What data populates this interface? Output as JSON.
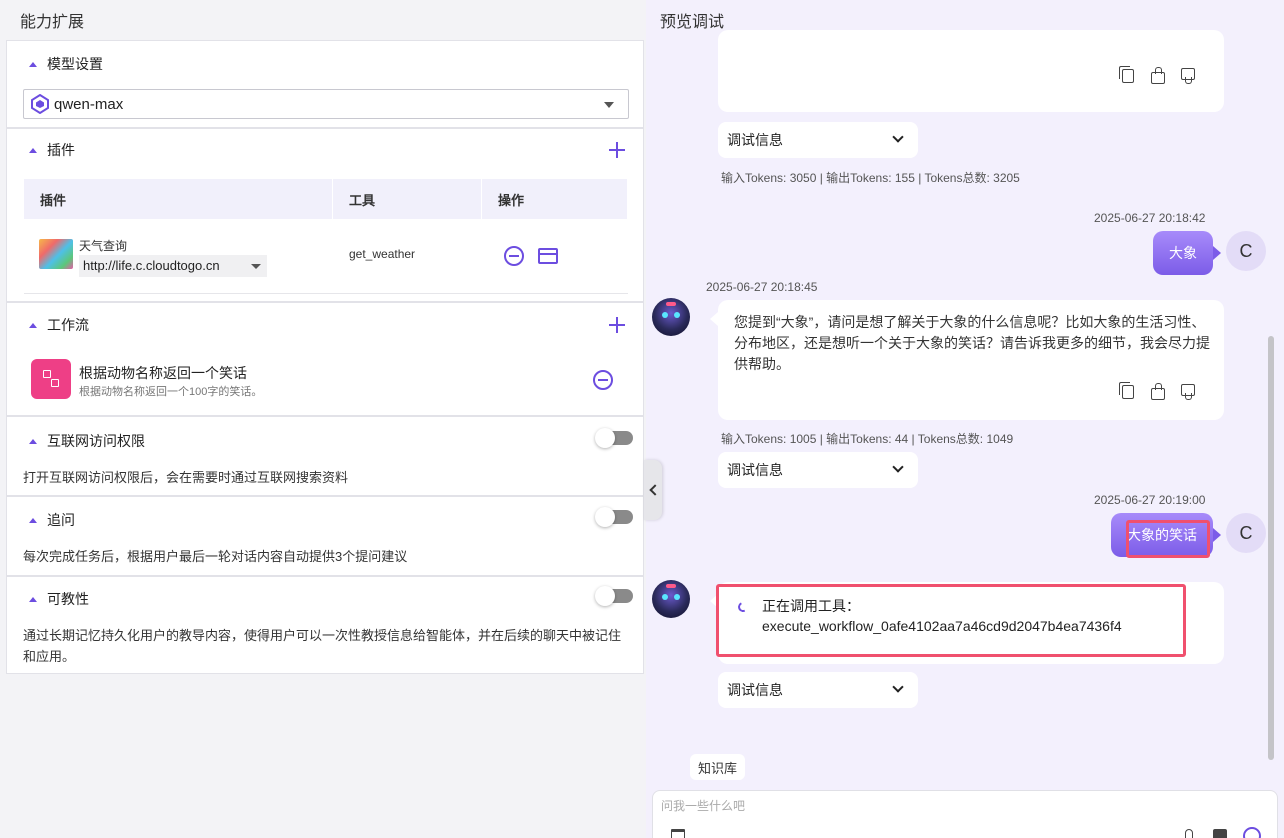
{
  "left_panel": {
    "title": "能力扩展",
    "model_section": {
      "title": "模型设置",
      "selected_model": "qwen-max"
    },
    "plugin_section": {
      "title": "插件",
      "columns": [
        "插件",
        "工具",
        "操作"
      ],
      "rows": [
        {
          "name": "天气查询",
          "url": "http://life.c.cloudtogo.cn",
          "tool": "get_weather"
        }
      ]
    },
    "workflow_section": {
      "title": "工作流",
      "items": [
        {
          "name": "根据动物名称返回一个笑话",
          "desc": "根据动物名称返回一个100字的笑话。"
        }
      ]
    },
    "internet_section": {
      "title": "互联网访问权限",
      "desc": "打开互联网访问权限后，会在需要时通过互联网搜索资料",
      "enabled": false
    },
    "followup_section": {
      "title": "追问",
      "desc": "每次完成任务后，根据用户最后一轮对话内容自动提供3个提问建议",
      "enabled": false
    },
    "teachable_section": {
      "title": "可教性",
      "desc": "通过长期记忆持久化用户的教导内容，使得用户可以一次性教授信息给智能体，并在后续的聊天中被记住和应用。",
      "enabled": false
    }
  },
  "right_panel": {
    "title": "预览调试",
    "debug_label": "调试信息",
    "messages": [
      {
        "role": "bot-tail",
        "tokens": "输入Tokens: 3050 |  输出Tokens: 155 |  Tokens总数: 3205"
      },
      {
        "role": "user",
        "time": "2025-06-27 20:18:42",
        "text": "大象",
        "avatar": "C"
      },
      {
        "role": "bot",
        "time": "2025-06-27 20:18:45",
        "text": "您提到“大象”，请问是想了解关于大象的什么信息呢？比如大象的生活习性、分布地区，还是想听一个关于大象的笑话？请告诉我更多的细节，我会尽力提供帮助。",
        "tokens": "输入Tokens: 1005 |  输出Tokens: 44 |  Tokens总数: 1049"
      },
      {
        "role": "user",
        "time": "2025-06-27 20:19:00",
        "text": "大象的笑话",
        "avatar": "C"
      },
      {
        "role": "bot",
        "status_label": "正在调用工具：",
        "tool_call": "execute_workflow_0afe4102aa7a46cd9d2047b4ea7436f4"
      }
    ],
    "knowledge_chip": "知识库",
    "input_placeholder": "问我一些什么吧"
  },
  "colors": {
    "accent": "#6c4de0",
    "highlight": "#f0506e",
    "user_bubble": "#8b6cf0"
  }
}
